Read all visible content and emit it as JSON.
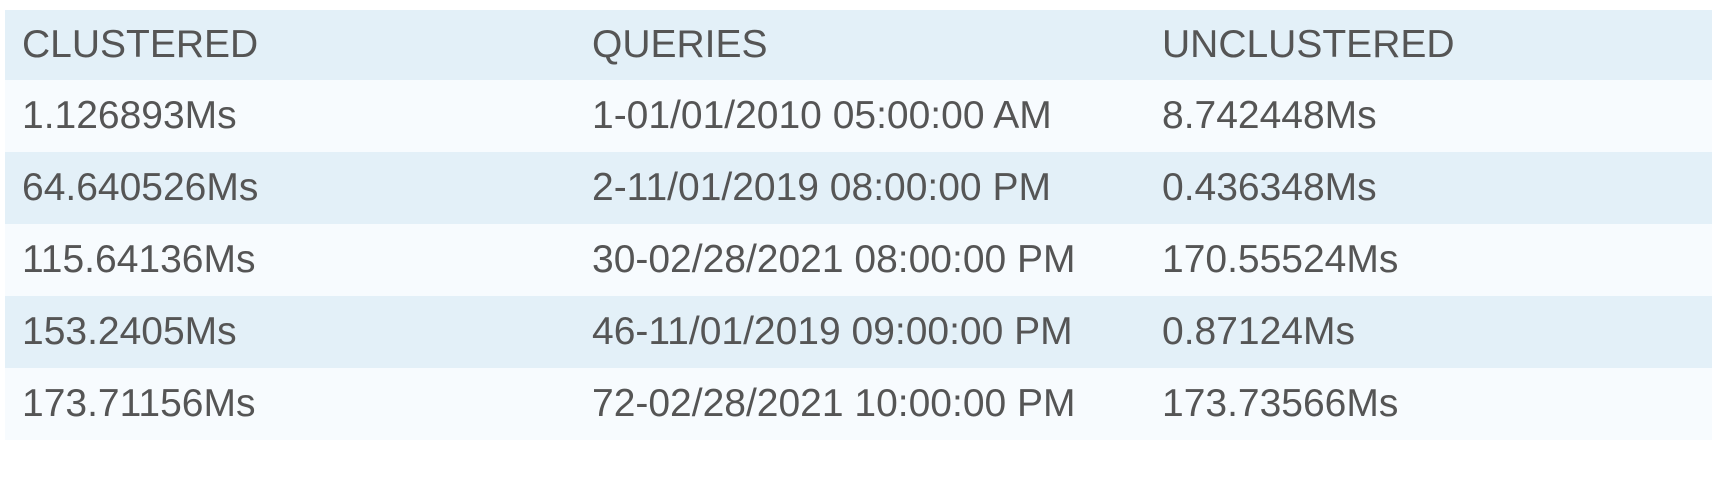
{
  "table": {
    "headers": [
      "CLUSTERED",
      "QUERIES",
      "UNCLUSTERED"
    ],
    "rows": [
      [
        "1.126893Ms",
        "1-01/01/2010 05:00:00 AM",
        "8.742448Ms"
      ],
      [
        "64.640526Ms",
        "2-11/01/2019 08:00:00 PM",
        "0.436348Ms"
      ],
      [
        "115.64136Ms",
        "30-02/28/2021 08:00:00 PM",
        "170.55524Ms"
      ],
      [
        "153.2405Ms",
        "46-11/01/2019 09:00:00 PM",
        "0.87124Ms"
      ],
      [
        "173.71156Ms",
        "72-02/28/2021 10:00:00 PM",
        "173.73566Ms"
      ]
    ]
  },
  "colors": {
    "header_bg": "#e3f0f8",
    "row_light": "#f7fbfe",
    "row_dark": "#e3f0f8",
    "text": "#555555"
  }
}
